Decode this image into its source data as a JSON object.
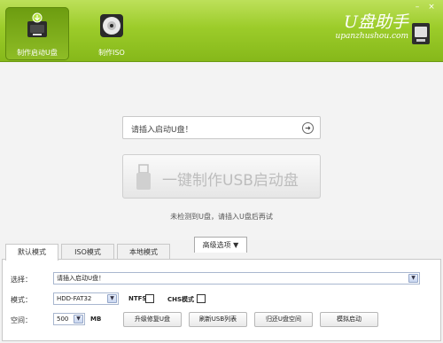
{
  "toolbar": {
    "tabs": [
      {
        "label": "制作启动U盘",
        "icon": "usb-drive-icon",
        "active": true
      },
      {
        "label": "制作ISO",
        "icon": "cd-disc-icon",
        "active": false
      }
    ]
  },
  "brand": {
    "name": "U盘助手",
    "url": "upanzhushou.com",
    "icon": "usb-drive-icon"
  },
  "window_controls": {
    "minimize": "–",
    "close": "×"
  },
  "colors": {
    "header_green": "#9ccc2a",
    "active_tab": "#6c9c10"
  },
  "main": {
    "status_text": "请插入启动U盘！",
    "status_arrow": "➜",
    "create_button": "一键制作USB启动盘",
    "hint": "未检测到U盘，请插入U盘后再试"
  },
  "advanced": {
    "label": "高级选项 ▼"
  },
  "mode_tabs": [
    {
      "label": "默认模式",
      "active": true
    },
    {
      "label": "ISO模式",
      "active": false
    },
    {
      "label": "本地模式",
      "active": false
    }
  ],
  "form": {
    "select_label": "选择：",
    "select_value": "请插入启动U盘！",
    "mode_label": "模式：",
    "mode_value": "HDD-FAT32",
    "ntfs_label": "NTFS",
    "chs_label": "CHS模式",
    "space_label": "空间：",
    "space_value": "500",
    "space_unit": "MB",
    "buttons": [
      "升级修复U盘",
      "刷新USB列表",
      "归还U盘空间",
      "模拟启动"
    ]
  }
}
